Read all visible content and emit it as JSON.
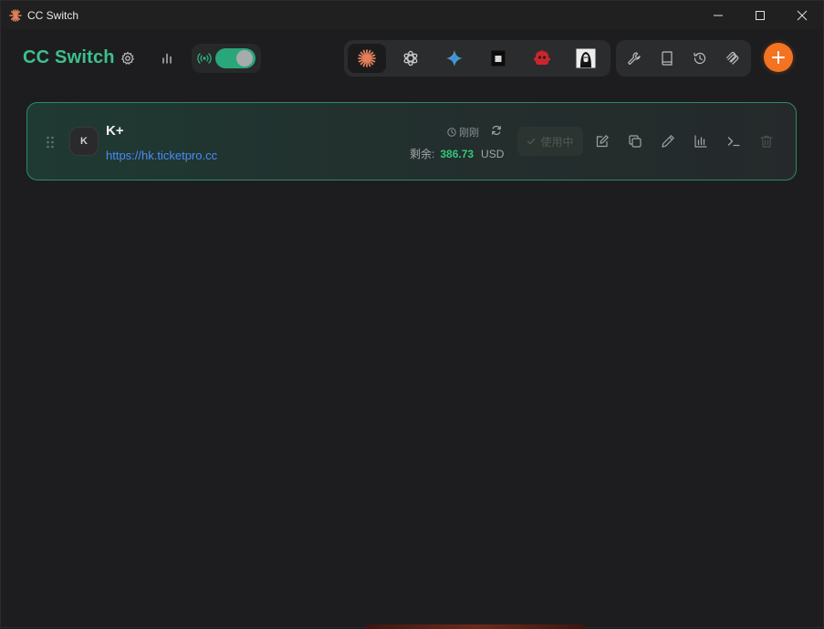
{
  "window": {
    "title": "CC Switch",
    "icon": "claude-sunburst-icon",
    "controls": [
      "minimize-icon",
      "maximize-icon",
      "close-icon"
    ]
  },
  "header": {
    "brand": "CC Switch",
    "settings_icon": "gear-icon",
    "usage_icon": "bar-chart-icon",
    "proxy_icon": "broadcast-icon",
    "proxy_enabled": true
  },
  "apps": {
    "items": [
      {
        "name": "claude",
        "icon": "claude-sunburst-icon",
        "active": true
      },
      {
        "name": "codex",
        "icon": "openai-icon",
        "active": false
      },
      {
        "name": "gemini",
        "icon": "gemini-star-icon",
        "active": false
      },
      {
        "name": "opencode",
        "icon": "opencode-square-icon",
        "active": false
      },
      {
        "name": "bot",
        "icon": "red-bot-icon",
        "active": false
      },
      {
        "name": "avatar-app",
        "icon": "portrait-icon",
        "active": false
      }
    ]
  },
  "tools": {
    "items": [
      "wrench-icon",
      "book-icon",
      "history-icon",
      "paperclip-icon"
    ]
  },
  "add_button": {
    "icon": "plus-icon"
  },
  "provider": {
    "avatar_letter": "K",
    "name": "K+",
    "url": "https://hk.ticketpro.cc",
    "updated": "刚刚",
    "balance_label": "剩余:",
    "balance_amount": "386.73",
    "balance_unit": "USD",
    "in_use_label": "使用中",
    "actions": [
      "edit-icon",
      "copy-icon",
      "pen-icon",
      "stats-icon",
      "terminal-icon",
      "trash-icon"
    ]
  },
  "colors": {
    "accent_green": "#3ec08d",
    "add_orange": "#f37321",
    "link_blue": "#4a8cf7",
    "balance_green": "#37c47a"
  }
}
